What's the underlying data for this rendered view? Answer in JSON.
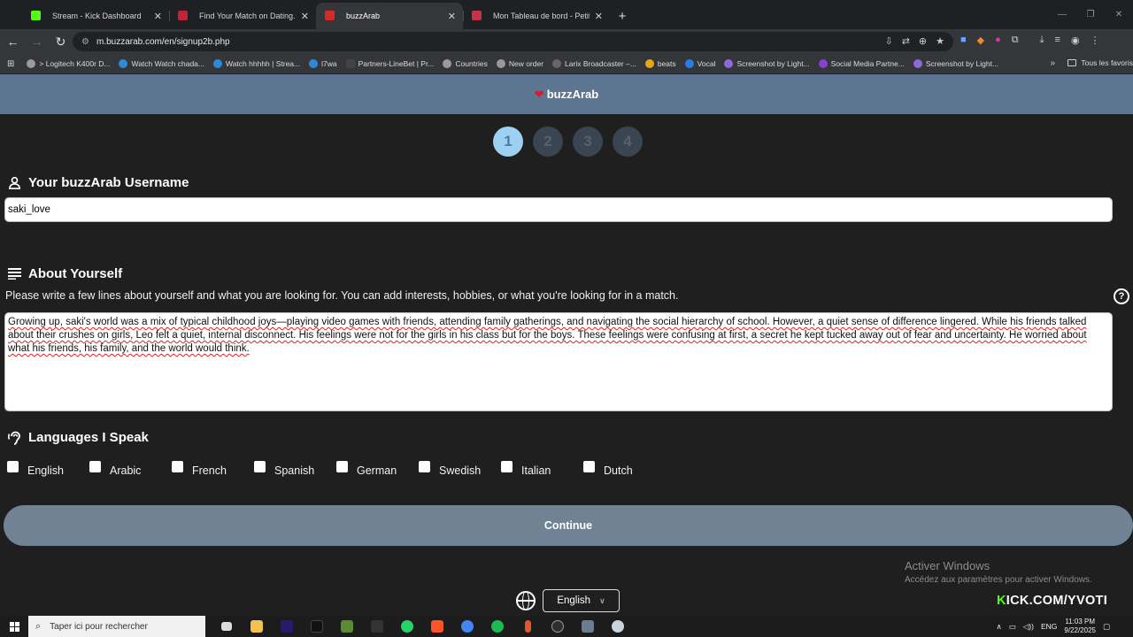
{
  "browser": {
    "tabs": [
      {
        "title": "Stream - Kick Dashboard",
        "color": "#53fc18",
        "active": false
      },
      {
        "title": "Find Your Match on Dating.com",
        "color": "#c0233a",
        "active": false
      },
      {
        "title": "buzzArab",
        "color": "#d42a2a",
        "active": true
      },
      {
        "title": "Mon Tableau de bord - Petites annonces",
        "color": "#c4324a",
        "active": false
      }
    ],
    "close_glyph": "✕",
    "new_tab_glyph": "+",
    "url": "m.buzzarab.com/en/signup2b.php",
    "bookmarks": [
      {
        "label": "> Logitech K400r D...",
        "color": "#9a9a9a"
      },
      {
        "label": "Watch Watch chada...",
        "color": "#2e8ad8"
      },
      {
        "label": "Watch hhhhh | Strea...",
        "color": "#2e8ad8"
      },
      {
        "label": "l7wa",
        "color": "#2e8ad8"
      },
      {
        "label": "Partners-LineBet | Pr...",
        "color": "#444444"
      },
      {
        "label": "Countries",
        "color": "#9a9a9a"
      },
      {
        "label": "New order",
        "color": "#9a9a9a"
      },
      {
        "label": "Larix Broadcaster –...",
        "color": "#666666"
      },
      {
        "label": "beats",
        "color": "#e6a817"
      },
      {
        "label": "Vocal",
        "color": "#2a7de1"
      },
      {
        "label": "Screenshot by Light...",
        "color": "#8a6bd8"
      },
      {
        "label": "Social Media Partne...",
        "color": "#8a3fd1"
      },
      {
        "label": "Screenshot by Light...",
        "color": "#8a6bd8"
      }
    ],
    "bookmarks_more": "»",
    "bookmarks_folder": "Tous les favoris"
  },
  "site": {
    "brand": "buzzArab",
    "steps": [
      "1",
      "2",
      "3",
      "4"
    ],
    "active_step": 1,
    "username_title": "Your buzzArab Username",
    "username_value": "saki_love",
    "about_title": "About Yourself",
    "about_hint": "Please write a few lines about yourself and what you are looking for. You can add interests, hobbies, or what you're looking for in a match.",
    "help_glyph": "?",
    "about_text": "Growing up, saki's world was a mix of typical childhood joys—playing video games with friends, attending family gatherings, and navigating the social hierarchy of school. However, a quiet sense of difference lingered. While his friends talked about their crushes on girls, Leo felt a quiet, internal disconnect. His feelings were not for the girls in his class but for the boys. These feelings were confusing at first, a secret he kept tucked away out of fear and uncertainty. He worried about what his friends, his family, and the world would think.",
    "languages_title": "Languages I Speak",
    "languages": [
      "English",
      "Arabic",
      "French",
      "Spanish",
      "German",
      "Swedish",
      "Italian",
      "Dutch"
    ],
    "continue_label": "Continue",
    "footer_language": "English"
  },
  "overlay": {
    "watermark_title": "Activer Windows",
    "watermark_sub": "Accédez aux paramètres pour activer Windows.",
    "kick_prefix": "K",
    "kick_rest": "ICK.COM/YVOTI"
  },
  "taskbar": {
    "search_placeholder": "Taper ici pour rechercher",
    "apps": [
      {
        "name": "task-view",
        "color": "#dddddd"
      },
      {
        "name": "file-explorer",
        "color": "#f2c14e"
      },
      {
        "name": "premiere",
        "color": "#2a1a6b"
      },
      {
        "name": "tiktok",
        "color": "#111111"
      },
      {
        "name": "minecraft",
        "color": "#5b8c32"
      },
      {
        "name": "epic",
        "color": "#333333"
      },
      {
        "name": "whatsapp",
        "color": "#25d366"
      },
      {
        "name": "brave",
        "color": "#fb542b"
      },
      {
        "name": "chrome",
        "color": "#4285f4"
      },
      {
        "name": "spotify",
        "color": "#1db954"
      },
      {
        "name": "mic",
        "color": "#e3572b"
      },
      {
        "name": "obs",
        "color": "#302e31"
      },
      {
        "name": "calculator",
        "color": "#6a7d92"
      },
      {
        "name": "steam",
        "color": "#c7d5e0"
      }
    ],
    "lang": "ENG",
    "time": "11:03 PM",
    "date": "9/22/2025"
  }
}
